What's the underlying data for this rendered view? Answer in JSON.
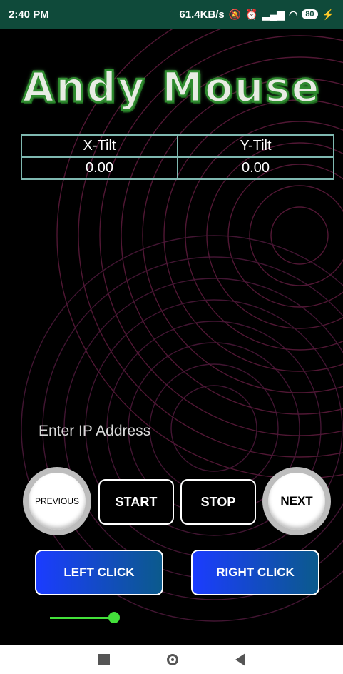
{
  "status": {
    "time": "2:40 PM",
    "network_speed": "61.4KB/s",
    "battery": "80"
  },
  "app": {
    "title": "Andy Mouse",
    "tilt_table": {
      "headers": [
        "X-Tilt",
        "Y-Tilt"
      ],
      "values": [
        "0.00",
        "0.00"
      ]
    },
    "ip_placeholder": "Enter IP Address",
    "buttons": {
      "previous": "PREVIOUS",
      "start": "START",
      "stop": "STOP",
      "next": "NEXT",
      "left_click": "LEFT CLICK",
      "right_click": "RIGHT CLICK"
    },
    "slider": {
      "value": 0.9
    }
  },
  "colors": {
    "status_bar": "#0f4a3a",
    "click_button_start": "#1b3cff",
    "click_button_end": "#0b5a8c",
    "slider": "#43e03a"
  },
  "icons": [
    "mute-icon",
    "alarm-icon",
    "volte-icon",
    "signal-icon",
    "wifi-icon",
    "battery-icon",
    "charging-icon",
    "recent-apps-icon",
    "home-icon",
    "back-icon"
  ]
}
